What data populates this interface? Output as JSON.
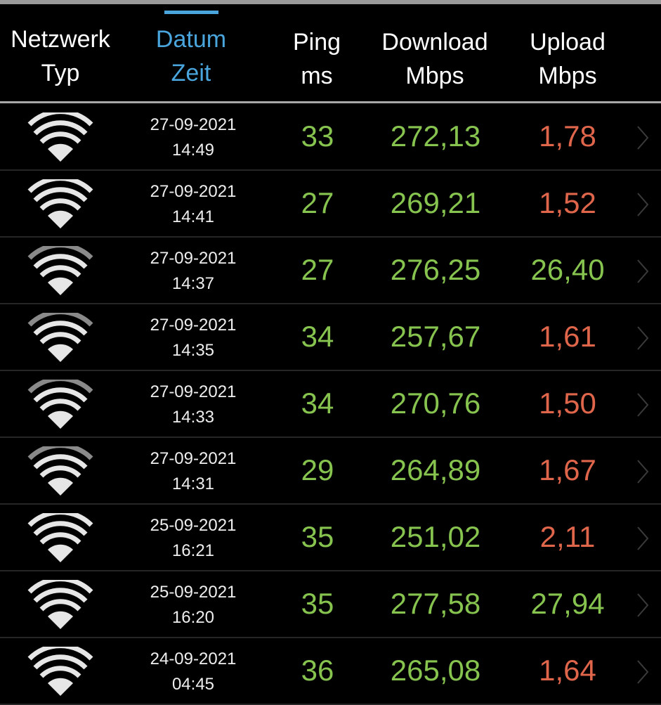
{
  "colors": {
    "accent": "#49a5dc",
    "good": "#86c34f",
    "bad": "#e0664b",
    "header_text": "#ffffff"
  },
  "header": {
    "network": {
      "line1": "Netzwerk",
      "line2": "Typ"
    },
    "datetime": {
      "line1": "Datum",
      "line2": "Zeit",
      "sorted": true
    },
    "ping": {
      "line1": "Ping",
      "line2": "ms"
    },
    "download": {
      "line1": "Download",
      "line2": "Mbps"
    },
    "upload": {
      "line1": "Upload",
      "line2": "Mbps"
    }
  },
  "rows": [
    {
      "icon": "wifi-icon",
      "signal_bars": 4,
      "date": "27-09-2021",
      "time": "14:49",
      "ping": "33",
      "download": "272,13",
      "upload": "1,78",
      "upload_status": "bad"
    },
    {
      "icon": "wifi-icon",
      "signal_bars": 4,
      "date": "27-09-2021",
      "time": "14:41",
      "ping": "27",
      "download": "269,21",
      "upload": "1,52",
      "upload_status": "bad"
    },
    {
      "icon": "wifi-icon",
      "signal_bars": 3,
      "date": "27-09-2021",
      "time": "14:37",
      "ping": "27",
      "download": "276,25",
      "upload": "26,40",
      "upload_status": "good"
    },
    {
      "icon": "wifi-icon",
      "signal_bars": 3,
      "date": "27-09-2021",
      "time": "14:35",
      "ping": "34",
      "download": "257,67",
      "upload": "1,61",
      "upload_status": "bad"
    },
    {
      "icon": "wifi-icon",
      "signal_bars": 3,
      "date": "27-09-2021",
      "time": "14:33",
      "ping": "34",
      "download": "270,76",
      "upload": "1,50",
      "upload_status": "bad"
    },
    {
      "icon": "wifi-icon",
      "signal_bars": 3,
      "date": "27-09-2021",
      "time": "14:31",
      "ping": "29",
      "download": "264,89",
      "upload": "1,67",
      "upload_status": "bad"
    },
    {
      "icon": "wifi-icon",
      "signal_bars": 4,
      "date": "25-09-2021",
      "time": "16:21",
      "ping": "35",
      "download": "251,02",
      "upload": "2,11",
      "upload_status": "bad"
    },
    {
      "icon": "wifi-icon",
      "signal_bars": 4,
      "date": "25-09-2021",
      "time": "16:20",
      "ping": "35",
      "download": "277,58",
      "upload": "27,94",
      "upload_status": "good"
    },
    {
      "icon": "wifi-icon",
      "signal_bars": 4,
      "date": "24-09-2021",
      "time": "04:45",
      "ping": "36",
      "download": "265,08",
      "upload": "1,64",
      "upload_status": "bad"
    }
  ]
}
